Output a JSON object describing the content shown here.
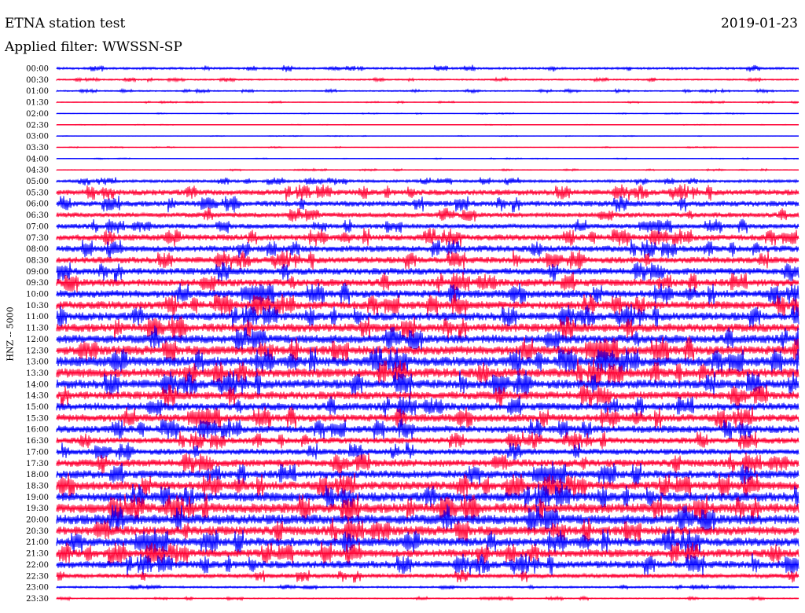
{
  "header": {
    "title": "ETNA station test",
    "date": "2019-01-23",
    "filter": "Applied filter: WWSSN-SP"
  },
  "chart_data": {
    "type": "line",
    "title": "ETNA station test",
    "subtitle": "Applied filter: WWSSN-SP",
    "ylabel": "HNZ -- 5000",
    "xlabel": "",
    "colors": [
      "#0000ff",
      "#ff0033"
    ],
    "grid": false,
    "series": [
      {
        "name": "00:00",
        "amplitude": 0.18
      },
      {
        "name": "00:30",
        "amplitude": 0.12
      },
      {
        "name": "01:00",
        "amplitude": 0.1
      },
      {
        "name": "01:30",
        "amplitude": 0.06
      },
      {
        "name": "02:00",
        "amplitude": 0.04
      },
      {
        "name": "02:30",
        "amplitude": 0.03
      },
      {
        "name": "03:00",
        "amplitude": 0.03
      },
      {
        "name": "03:30",
        "amplitude": 0.04
      },
      {
        "name": "04:00",
        "amplitude": 0.04
      },
      {
        "name": "04:30",
        "amplitude": 0.06
      },
      {
        "name": "05:00",
        "amplitude": 0.22
      },
      {
        "name": "05:30",
        "amplitude": 0.45
      },
      {
        "name": "06:00",
        "amplitude": 0.45
      },
      {
        "name": "06:30",
        "amplitude": 0.4
      },
      {
        "name": "07:00",
        "amplitude": 0.4
      },
      {
        "name": "07:30",
        "amplitude": 0.5
      },
      {
        "name": "08:00",
        "amplitude": 0.52
      },
      {
        "name": "08:30",
        "amplitude": 0.52
      },
      {
        "name": "09:00",
        "amplitude": 0.55
      },
      {
        "name": "09:30",
        "amplitude": 0.6
      },
      {
        "name": "10:00",
        "amplitude": 0.62
      },
      {
        "name": "10:30",
        "amplitude": 0.65
      },
      {
        "name": "11:00",
        "amplitude": 0.65
      },
      {
        "name": "11:30",
        "amplitude": 0.68
      },
      {
        "name": "12:00",
        "amplitude": 0.7
      },
      {
        "name": "12:30",
        "amplitude": 0.75
      },
      {
        "name": "13:00",
        "amplitude": 0.78
      },
      {
        "name": "13:30",
        "amplitude": 0.75
      },
      {
        "name": "14:00",
        "amplitude": 0.72
      },
      {
        "name": "14:30",
        "amplitude": 0.65
      },
      {
        "name": "15:00",
        "amplitude": 0.62
      },
      {
        "name": "15:30",
        "amplitude": 0.62
      },
      {
        "name": "16:00",
        "amplitude": 0.6
      },
      {
        "name": "16:30",
        "amplitude": 0.5
      },
      {
        "name": "17:00",
        "amplitude": 0.48
      },
      {
        "name": "17:30",
        "amplitude": 0.6
      },
      {
        "name": "18:00",
        "amplitude": 0.65
      },
      {
        "name": "18:30",
        "amplitude": 0.7
      },
      {
        "name": "19:00",
        "amplitude": 0.75
      },
      {
        "name": "19:30",
        "amplitude": 0.8
      },
      {
        "name": "20:00",
        "amplitude": 0.8
      },
      {
        "name": "20:30",
        "amplitude": 0.75
      },
      {
        "name": "21:00",
        "amplitude": 0.7
      },
      {
        "name": "21:30",
        "amplitude": 0.65
      },
      {
        "name": "22:00",
        "amplitude": 0.6
      },
      {
        "name": "22:30",
        "amplitude": 0.35
      },
      {
        "name": "23:00",
        "amplitude": 0.15
      },
      {
        "name": "23:30",
        "amplitude": 0.1
      }
    ]
  }
}
